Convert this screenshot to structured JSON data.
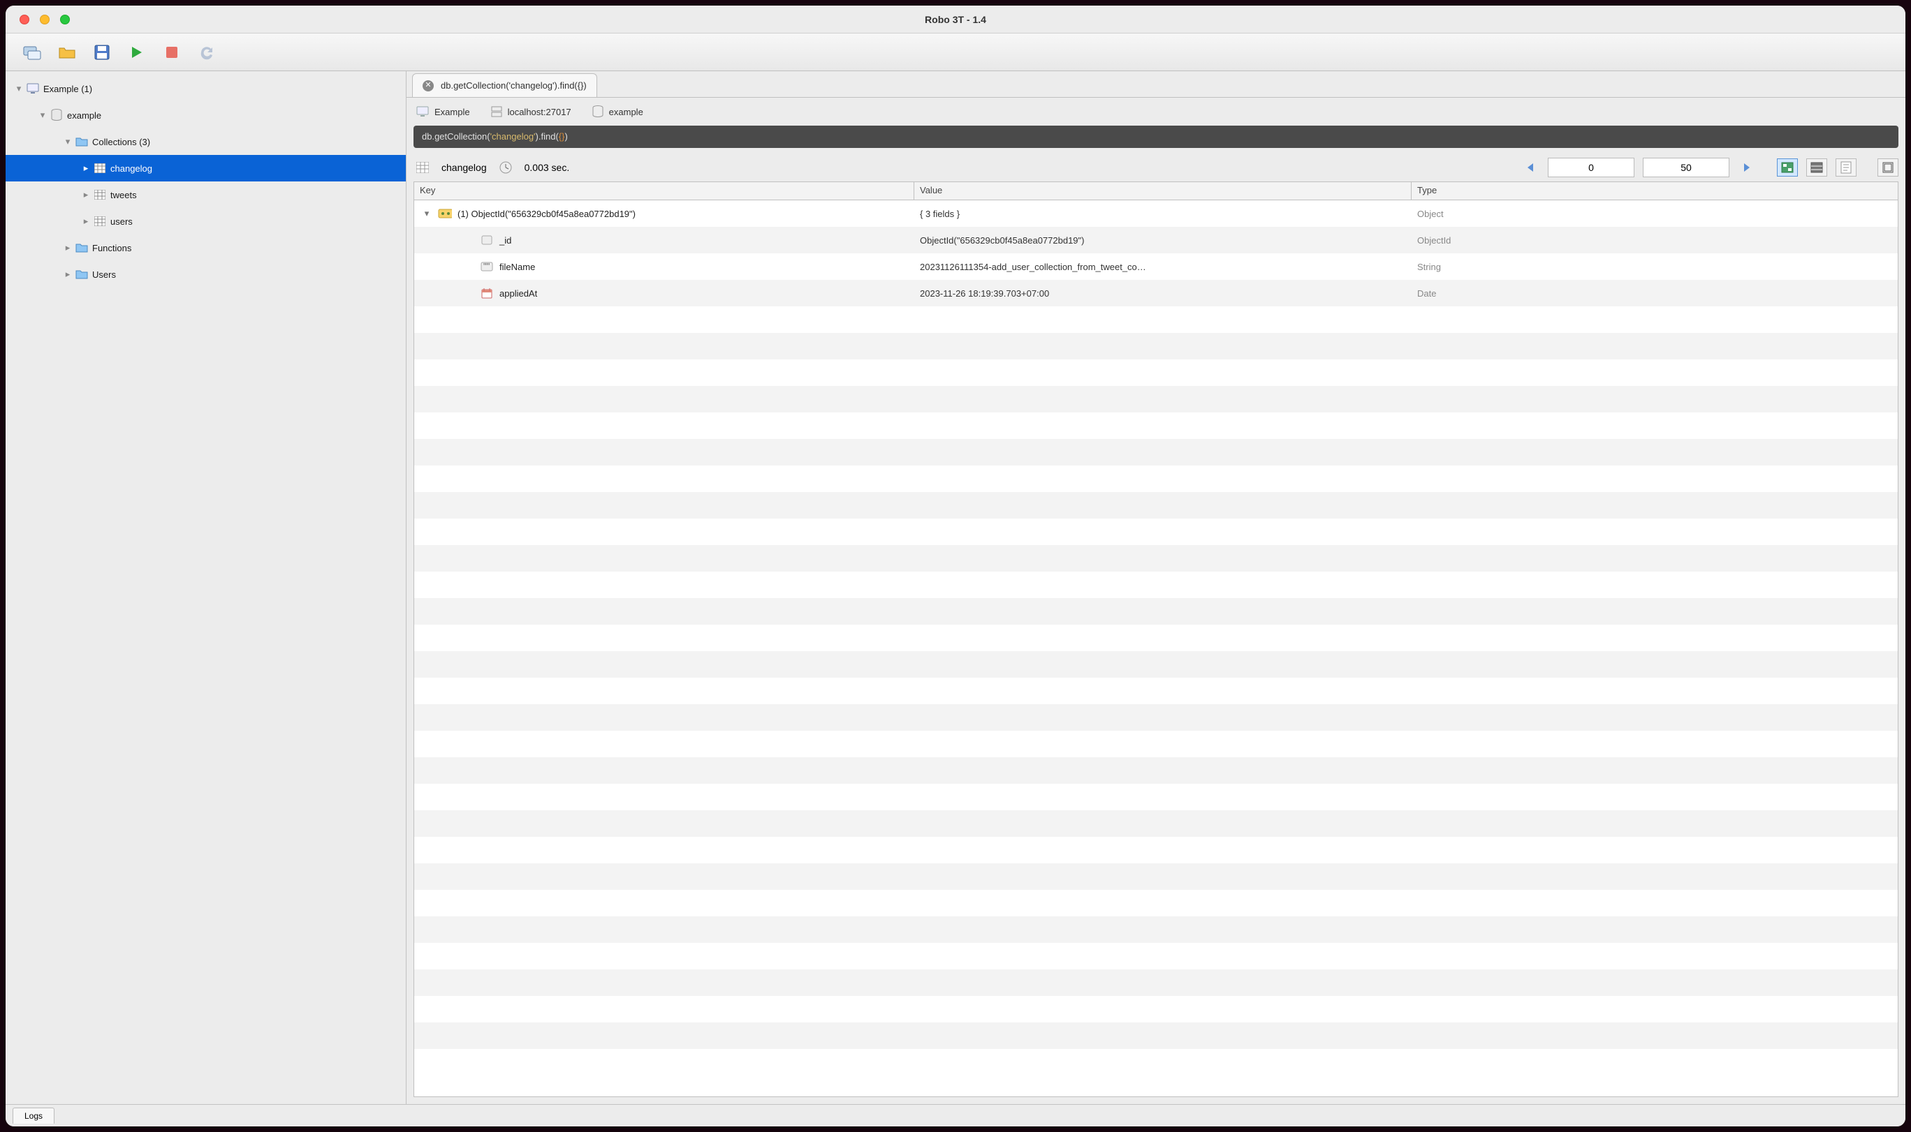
{
  "window": {
    "title": "Robo 3T - 1.4"
  },
  "tree": {
    "connection": "Example (1)",
    "database": "example",
    "collectionsLabel": "Collections (3)",
    "collections": [
      "changelog",
      "tweets",
      "users"
    ],
    "functions": "Functions",
    "users": "Users"
  },
  "tab": {
    "label": "db.getCollection('changelog').find({})"
  },
  "context": {
    "connection": "Example",
    "host": "localhost:27017",
    "database": "example"
  },
  "query": {
    "prefix": "db",
    "method1": ".getCollection(",
    "arg": "'changelog'",
    "method2": ").find(",
    "braces": "{}",
    "close": ")"
  },
  "resultBar": {
    "collection": "changelog",
    "time": "0.003 sec.",
    "offset": "0",
    "limit": "50"
  },
  "columns": {
    "key": "Key",
    "value": "Value",
    "type": "Type"
  },
  "rows": [
    {
      "indent": 0,
      "twist": "▾",
      "icon": "object",
      "key": "(1) ObjectId(\"656329cb0f45a8ea0772bd19\")",
      "value": "{ 3 fields }",
      "type": "Object"
    },
    {
      "indent": 1,
      "twist": "",
      "icon": "id",
      "key": "_id",
      "value": "ObjectId(\"656329cb0f45a8ea0772bd19\")",
      "type": "ObjectId"
    },
    {
      "indent": 1,
      "twist": "",
      "icon": "string",
      "key": "fileName",
      "value": "20231126111354-add_user_collection_from_tweet_co…",
      "type": "String"
    },
    {
      "indent": 1,
      "twist": "",
      "icon": "date",
      "key": "appliedAt",
      "value": "2023-11-26 18:19:39.703+07:00",
      "type": "Date"
    }
  ],
  "status": {
    "logs": "Logs"
  }
}
